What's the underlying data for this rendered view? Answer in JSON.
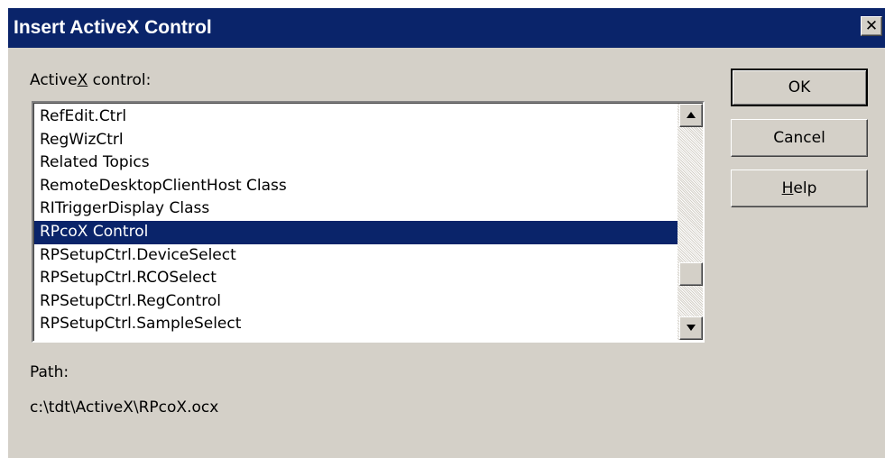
{
  "dialog": {
    "title": "Insert ActiveX Control"
  },
  "activex_label": {
    "before": "Active",
    "accel": "X",
    "after": " control:"
  },
  "controls_list": {
    "items": [
      "RefEdit.Ctrl",
      "RegWizCtrl",
      "Related Topics",
      "RemoteDesktopClientHost Class",
      "RITriggerDisplay Class",
      "RPcoX Control",
      "RPSetupCtrl.DeviceSelect",
      "RPSetupCtrl.RCOSelect",
      "RPSetupCtrl.RegControl",
      "RPSetupCtrl.SampleSelect"
    ],
    "selected": "RPcoX Control"
  },
  "buttons": {
    "ok": "OK",
    "cancel": "Cancel",
    "help_accel": "H",
    "help_rest": "elp"
  },
  "path": {
    "label": "Path:",
    "value": "c:\\tdt\\ActiveX\\RPcoX.ocx"
  },
  "close_glyph": "✕",
  "colors": {
    "titlebar": "#0a246a",
    "dialog_bg": "#d4d0c8",
    "selection": "#0a246a"
  }
}
